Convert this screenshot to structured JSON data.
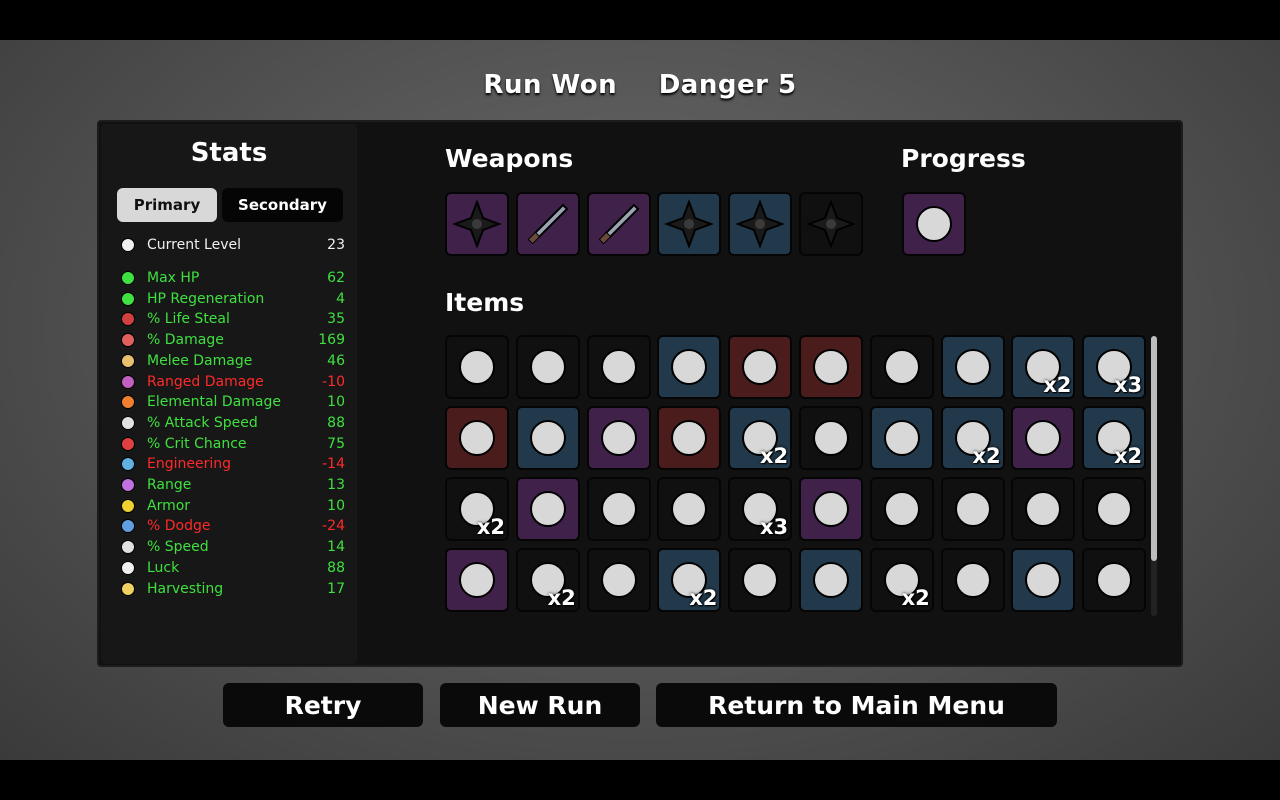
{
  "header": {
    "result": "Run Won",
    "danger": "Danger 5"
  },
  "stats": {
    "title": "Stats",
    "tabs": {
      "primary": "Primary",
      "secondary": "Secondary"
    },
    "level": {
      "label": "Current Level",
      "value": "23",
      "icon": "skull-icon",
      "color": "#f0f0f0"
    },
    "rows": [
      {
        "label": "Max HP",
        "value": "62",
        "tone": "green",
        "icon": "heart-icon",
        "color": "#3fe03f"
      },
      {
        "label": "HP Regeneration",
        "value": "4",
        "tone": "green",
        "icon": "heart-plus-icon",
        "color": "#3fe03f"
      },
      {
        "label": "% Life Steal",
        "value": "35",
        "tone": "green",
        "icon": "fangs-icon",
        "color": "#d04040"
      },
      {
        "label": "% Damage",
        "value": "169",
        "tone": "green",
        "icon": "muscle-icon",
        "color": "#e06060"
      },
      {
        "label": "Melee Damage",
        "value": "46",
        "tone": "green",
        "icon": "sword-icon",
        "color": "#e8c070"
      },
      {
        "label": "Ranged Damage",
        "value": "-10",
        "tone": "red",
        "icon": "bow-icon",
        "color": "#c060c0"
      },
      {
        "label": "Elemental Damage",
        "value": "10",
        "tone": "green",
        "icon": "flame-icon",
        "color": "#f08030"
      },
      {
        "label": "% Attack Speed",
        "value": "88",
        "tone": "green",
        "icon": "hourglass-icon",
        "color": "#e0e0e0"
      },
      {
        "label": "% Crit Chance",
        "value": "75",
        "tone": "green",
        "icon": "crit-icon",
        "color": "#e04040"
      },
      {
        "label": "Engineering",
        "value": "-14",
        "tone": "red",
        "icon": "wrench-icon",
        "color": "#60b0e0"
      },
      {
        "label": "Range",
        "value": "13",
        "tone": "green",
        "icon": "range-icon",
        "color": "#c070e0"
      },
      {
        "label": "Armor",
        "value": "10",
        "tone": "green",
        "icon": "shield-icon",
        "color": "#f0d030"
      },
      {
        "label": "% Dodge",
        "value": "-24",
        "tone": "red",
        "icon": "dodge-icon",
        "color": "#60a0e0"
      },
      {
        "label": "% Speed",
        "value": "14",
        "tone": "green",
        "icon": "boot-icon",
        "color": "#e0e0e0"
      },
      {
        "label": "Luck",
        "value": "88",
        "tone": "green",
        "icon": "dice-icon",
        "color": "#f0f0f0"
      },
      {
        "label": "Harvesting",
        "value": "17",
        "tone": "green",
        "icon": "wheat-icon",
        "color": "#f0d060"
      }
    ]
  },
  "weapons": {
    "title": "Weapons",
    "slots": [
      {
        "name": "shuriken",
        "tier": "purple",
        "icon": "shuriken-icon"
      },
      {
        "name": "knife",
        "tier": "purple",
        "icon": "knife-icon"
      },
      {
        "name": "green-knife",
        "tier": "purple",
        "icon": "green-knife-icon"
      },
      {
        "name": "shuriken",
        "tier": "blue",
        "icon": "shuriken-icon"
      },
      {
        "name": "shuriken",
        "tier": "blue",
        "icon": "shuriken-icon"
      },
      {
        "name": "shuriken",
        "tier": "dark",
        "icon": "shuriken-icon"
      }
    ]
  },
  "progress": {
    "title": "Progress",
    "slots": [
      {
        "name": "horned-head",
        "tier": "purple",
        "icon": "horned-head-icon"
      }
    ]
  },
  "items": {
    "title": "Items",
    "rows": [
      [
        {
          "icon": "egg-icon",
          "tier": "dark",
          "qty": ""
        },
        {
          "icon": "coffee-cup-icon",
          "tier": "dark",
          "qty": ""
        },
        {
          "icon": "snake-icon",
          "tier": "dark",
          "qty": ""
        },
        {
          "icon": "masked-spider-icon",
          "tier": "blue",
          "qty": ""
        },
        {
          "icon": "binoculars-icon",
          "tier": "red",
          "qty": ""
        },
        {
          "icon": "wolf-head-icon",
          "tier": "red",
          "qty": ""
        },
        {
          "icon": "cake-slice-icon",
          "tier": "dark",
          "qty": ""
        },
        {
          "icon": "stone-icon",
          "tier": "blue",
          "qty": ""
        },
        {
          "icon": "necklace-icon",
          "tier": "blue",
          "qty": "x2"
        },
        {
          "icon": "claws-icon",
          "tier": "blue",
          "qty": "x3"
        }
      ],
      [
        {
          "icon": "vial-icon",
          "tier": "red",
          "qty": ""
        },
        {
          "icon": "turret-icon",
          "tier": "blue",
          "qty": ""
        },
        {
          "icon": "alchemy-icon",
          "tier": "purple",
          "qty": ""
        },
        {
          "icon": "bandage-hand-icon",
          "tier": "red",
          "qty": ""
        },
        {
          "icon": "scroll-icon",
          "tier": "blue",
          "qty": "x2"
        },
        {
          "icon": "duck-icon",
          "tier": "dark",
          "qty": ""
        },
        {
          "icon": "machine-icon",
          "tier": "blue",
          "qty": ""
        },
        {
          "icon": "wrench-tool-icon",
          "tier": "blue",
          "qty": "x2"
        },
        {
          "icon": "mortar-icon",
          "tier": "purple",
          "qty": ""
        },
        {
          "icon": "tentacle-icon",
          "tier": "blue",
          "qty": "x2"
        }
      ],
      [
        {
          "icon": "hedgehog-icon",
          "tier": "dark",
          "qty": "x2"
        },
        {
          "icon": "rat-icon",
          "tier": "purple",
          "qty": ""
        },
        {
          "icon": "bucket-icon",
          "tier": "dark",
          "qty": ""
        },
        {
          "icon": "tooth-icon",
          "tier": "dark",
          "qty": ""
        },
        {
          "icon": "bat-icon",
          "tier": "dark",
          "qty": "x3"
        },
        {
          "icon": "crystal-icon",
          "tier": "purple",
          "qty": ""
        },
        {
          "icon": "worm-icon",
          "tier": "dark",
          "qty": ""
        },
        {
          "icon": "red-glove-icon",
          "tier": "dark",
          "qty": ""
        },
        {
          "icon": "hamster-icon",
          "tier": "dark",
          "qty": ""
        },
        {
          "icon": "helmet-icon",
          "tier": "dark",
          "qty": ""
        }
      ],
      [
        {
          "icon": "angel-bulb-icon",
          "tier": "purple",
          "qty": ""
        },
        {
          "icon": "fairy-icon",
          "tier": "dark",
          "qty": "x2"
        },
        {
          "icon": "mushroom-icon",
          "tier": "dark",
          "qty": ""
        },
        {
          "icon": "bullet-icon",
          "tier": "blue",
          "qty": "x2"
        },
        {
          "icon": "cash-icon",
          "tier": "dark",
          "qty": ""
        },
        {
          "icon": "glasses-icon",
          "tier": "blue",
          "qty": ""
        },
        {
          "icon": "syringe-icon",
          "tier": "dark",
          "qty": "x2"
        },
        {
          "icon": "ghost-face-icon",
          "tier": "dark",
          "qty": ""
        },
        {
          "icon": "bunny-icon",
          "tier": "blue",
          "qty": ""
        },
        {
          "icon": "bandaged-head-icon",
          "tier": "dark",
          "qty": ""
        }
      ]
    ]
  },
  "buttons": {
    "retry": "Retry",
    "new_run": "New Run",
    "main_menu": "Return to Main Menu"
  }
}
